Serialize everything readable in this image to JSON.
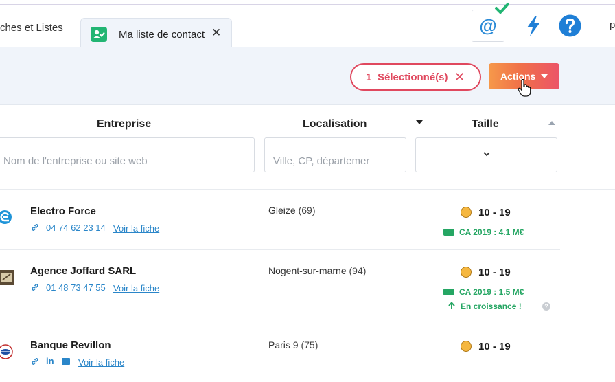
{
  "tabs": {
    "previous_label": "ches et Listes",
    "active_label": "Ma liste de contact",
    "close_glyph": "✕"
  },
  "header": {
    "email_glyph": "@",
    "user_initial": "p"
  },
  "toolbar": {
    "selected_count": "1",
    "selected_label": "Sélectionné(s)",
    "clear_glyph": "✕",
    "actions_label": "Actions"
  },
  "columns": {
    "company": "Entreprise",
    "location": "Localisation",
    "size": "Taille"
  },
  "filters": {
    "company_placeholder": "Nom de l'entreprise ou site web",
    "location_placeholder": "Ville, CP, départemer"
  },
  "rows": [
    {
      "company": "Electro Force",
      "phone": "04 74 62 23 14",
      "fiche": "Voir la fiche",
      "city": "Gleize",
      "dept": "(69)",
      "size": "10 - 19",
      "ca": "CA 2019 : 4.1 M€"
    },
    {
      "company": "Agence Joffard SARL",
      "phone": "01 48 73 47 55",
      "fiche": "Voir la fiche",
      "city": "Nogent-sur-marne",
      "dept": "(94)",
      "size": "10 - 19",
      "ca": "CA 2019 : 1.5 M€",
      "growth": "En croissance !"
    },
    {
      "company": "Banque Revillon",
      "fiche": "Voir la fiche",
      "city": "Paris 9",
      "dept": "(75)",
      "size": "10 - 19",
      "linkedin_glyph": "in"
    }
  ],
  "colors": {
    "accent_red": "#e0485e",
    "accent_orange": "#f6994a",
    "link_blue": "#2a86c9",
    "success_green": "#25a663",
    "tab_icon_green": "#22b573"
  },
  "icons": [
    "contact-list-icon",
    "email-verified-icon",
    "bolt-icon",
    "help-icon",
    "link-icon",
    "linkedin-icon",
    "mail-icon",
    "face-icon",
    "money-icon",
    "arrow-up-icon",
    "question-icon",
    "chevron-down-icon",
    "hand-cursor-icon"
  ]
}
